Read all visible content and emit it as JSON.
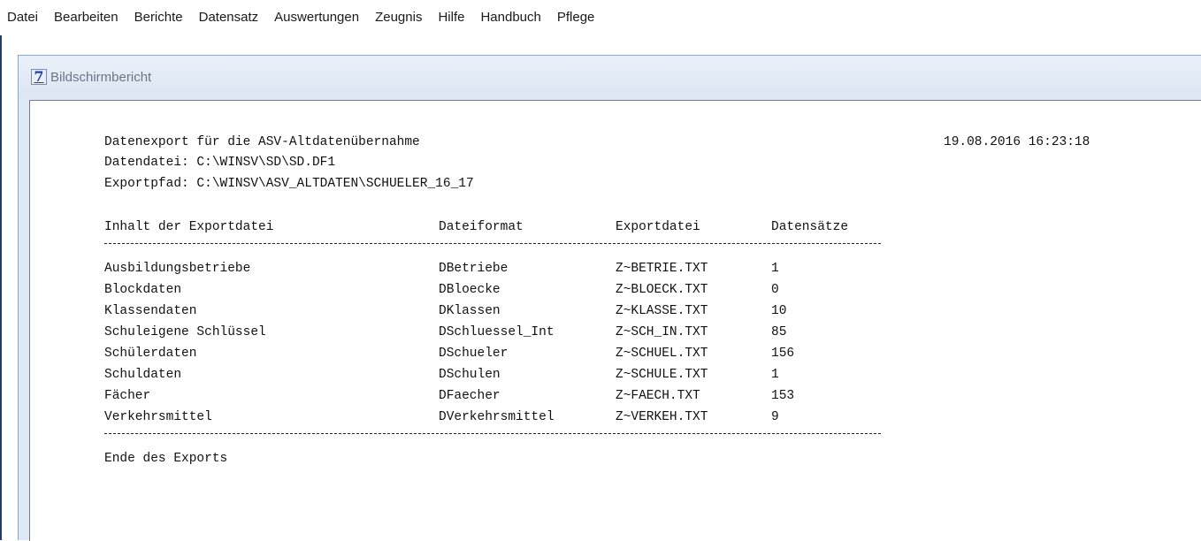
{
  "menu": [
    "Datei",
    "Bearbeiten",
    "Berichte",
    "Datensatz",
    "Auswertungen",
    "Zeugnis",
    "Hilfe",
    "Handbuch",
    "Pflege"
  ],
  "window": {
    "title": "Bildschirmbericht",
    "icon_glyph": "7",
    "icon": "app-7-icon"
  },
  "report": {
    "heading": "Datenexport für die ASV-Altdatenübernahme",
    "timestamp": "19.08.2016 16:23:18",
    "datafile": "Datendatei: C:\\WINSV\\SD\\SD.DF1",
    "exportpath": "Exportpfad: C:\\WINSV\\ASV_ALTDATEN\\SCHUELER_16_17",
    "columns": [
      "Inhalt der Exportdatei",
      "Dateiformat",
      "Exportdatei",
      "Datensätze"
    ],
    "rows": [
      [
        "Ausbildungsbetriebe",
        "DBetriebe",
        "Z~BETRIE.TXT",
        "1"
      ],
      [
        "Blockdaten",
        "DBloecke",
        "Z~BLOECK.TXT",
        "0"
      ],
      [
        "Klassendaten",
        "DKlassen",
        "Z~KLASSE.TXT",
        "10"
      ],
      [
        "Schuleigene Schlüssel",
        "DSchluessel_Int",
        "Z~SCH_IN.TXT",
        "85"
      ],
      [
        "Schülerdaten",
        "DSchueler",
        "Z~SCHUEL.TXT",
        "156"
      ],
      [
        "Schuldaten",
        "DSchulen",
        "Z~SCHULE.TXT",
        "1"
      ],
      [
        "Fächer",
        "DFaecher",
        "Z~FAECH.TXT",
        "153"
      ],
      [
        "Verkehrsmittel",
        "DVerkehrsmittel",
        "Z~VERKEH.TXT",
        "9"
      ]
    ],
    "footer": "Ende des Exports"
  }
}
